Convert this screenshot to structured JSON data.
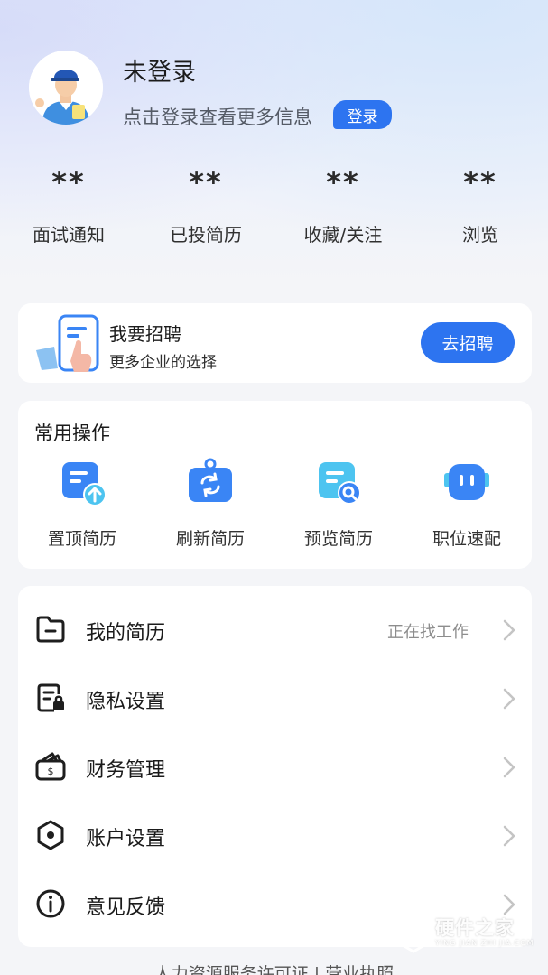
{
  "profile": {
    "name": "未登录",
    "tip": "点击登录查看更多信息",
    "login_label": "登录"
  },
  "stats": [
    {
      "value": "**",
      "label": "面试通知"
    },
    {
      "value": "**",
      "label": "已投简历"
    },
    {
      "value": "**",
      "label": "收藏/关注"
    },
    {
      "value": "**",
      "label": "浏览"
    }
  ],
  "recruit": {
    "title": "我要招聘",
    "subtitle": "更多企业的选择",
    "button_label": "去招聘"
  },
  "operations": {
    "title": "常用操作",
    "items": [
      {
        "label": "置顶简历",
        "icon": "resume-top-icon"
      },
      {
        "label": "刷新简历",
        "icon": "refresh-resume-icon"
      },
      {
        "label": "预览简历",
        "icon": "preview-resume-icon"
      },
      {
        "label": "职位速配",
        "icon": "job-match-icon"
      }
    ]
  },
  "menu": {
    "items": [
      {
        "label": "我的简历",
        "extra": "正在找工作",
        "icon": "folder-icon"
      },
      {
        "label": "隐私设置",
        "extra": "",
        "icon": "privacy-lock-icon"
      },
      {
        "label": "财务管理",
        "extra": "",
        "icon": "wallet-icon"
      },
      {
        "label": "账户设置",
        "extra": "",
        "icon": "hexagon-settings-icon"
      },
      {
        "label": "意见反馈",
        "extra": "",
        "icon": "info-icon"
      }
    ]
  },
  "footer": {
    "text": "人力资源服务许可证 | 营业执照"
  },
  "watermark": {
    "text": "硬件之家",
    "sub": "YING JIAN ZHI JIA.COM"
  },
  "colors": {
    "accent": "#2d74f0",
    "icon_blue": "#3a85f5",
    "icon_cyan": "#4dc4f0"
  }
}
